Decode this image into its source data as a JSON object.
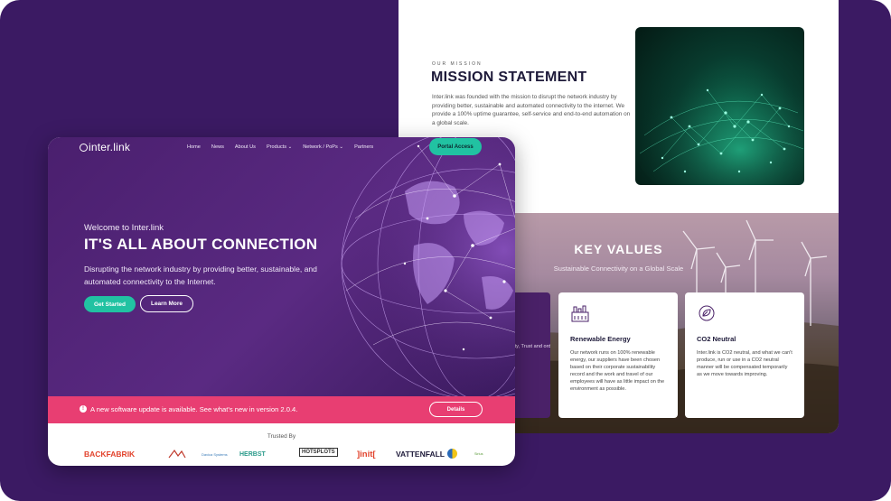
{
  "mission": {
    "kicker": "OUR MISSION",
    "title": "MISSION STATEMENT",
    "text": "Inter.link was founded with the mission to disrupt the network industry by providing better, sustainable and automated connectivity to the internet. We provide a 100% uptime guarantee, self-service and end-to-end automation on a global scale."
  },
  "key_values": {
    "title": "KEY VALUES",
    "subtitle": "Sustainable Connectivity on a Global Scale",
    "dark_card_text": "h high quality, Trust and ord- s a rk",
    "cards": [
      {
        "icon": "factory-icon",
        "title": "Renewable Energy",
        "text": "Our network runs on 100% renewable energy, our suppliers have been chosen based on their corporate sustainability record and the work and travel of our employees will have as little impact on the environment as possible."
      },
      {
        "icon": "leaf-co2-icon",
        "title": "CO2 Neutral",
        "text": "Inter.link is CO2 neutral, and what we can't produce, run or use in a CO2 neutral manner will be compensated temporarily as we move towards improving."
      }
    ]
  },
  "front": {
    "logo": "inter.link",
    "nav": [
      "Home",
      "News",
      "About Us",
      "Products",
      "Network / PoPs",
      "Partners"
    ],
    "portal_label": "Portal Access",
    "welcome": "Welcome to Inter.link",
    "title": "IT'S ALL ABOUT CONNECTION",
    "subtitle": "Disrupting the network industry by providing better, sustainable, and automated connectivity to the Internet.",
    "get_started": "Get Started",
    "learn_more": "Learn More",
    "update_text": "A new software update is available. See what's new in version 2.0.4.",
    "details_label": "Details",
    "trusted_label": "Trusted By",
    "brands": [
      "BACKFABRIK",
      "Davica Systems",
      "HERBST",
      "HOTSPLOTS",
      "]init[",
      "VATTENFALL",
      "Sirius"
    ]
  },
  "colors": {
    "background": "#3b1a63",
    "accent": "#21c2a2",
    "alert": "#e83e72",
    "hero": "#4a1f6e"
  }
}
